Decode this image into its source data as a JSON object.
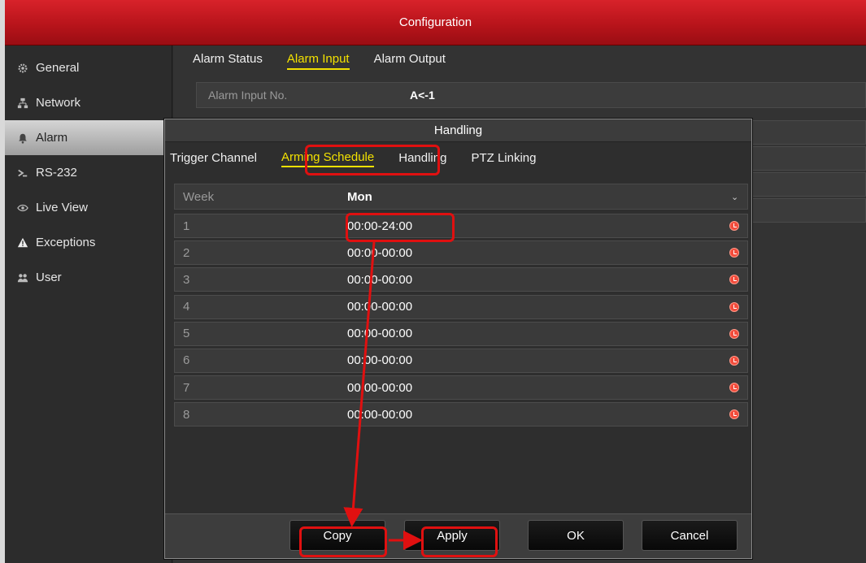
{
  "window": {
    "title": "Configuration"
  },
  "sidebar": {
    "items": [
      {
        "label": "General",
        "icon": "gear-icon"
      },
      {
        "label": "Network",
        "icon": "network-icon"
      },
      {
        "label": "Alarm",
        "icon": "bell-icon"
      },
      {
        "label": "RS-232",
        "icon": "serial-port-icon"
      },
      {
        "label": "Live View",
        "icon": "eye-icon"
      },
      {
        "label": "Exceptions",
        "icon": "warning-icon"
      },
      {
        "label": "User",
        "icon": "users-icon"
      }
    ],
    "active_index": 2
  },
  "content": {
    "tabs": [
      "Alarm Status",
      "Alarm Input",
      "Alarm Output"
    ],
    "active_tab": "Alarm Input",
    "alarm_input_label": "Alarm Input No.",
    "alarm_input_value": "A<-1"
  },
  "dialog": {
    "title": "Handling",
    "tabs": [
      "Trigger Channel",
      "Arming Schedule",
      "Handling",
      "PTZ Linking"
    ],
    "active_tab": "Arming Schedule",
    "week_label": "Week",
    "week_value": "Mon",
    "schedule": [
      {
        "num": "1",
        "time": "00:00-24:00"
      },
      {
        "num": "2",
        "time": "00:00-00:00"
      },
      {
        "num": "3",
        "time": "00:00-00:00"
      },
      {
        "num": "4",
        "time": "00:00-00:00"
      },
      {
        "num": "5",
        "time": "00:00-00:00"
      },
      {
        "num": "6",
        "time": "00:00-00:00"
      },
      {
        "num": "7",
        "time": "00:00-00:00"
      },
      {
        "num": "8",
        "time": "00:00-00:00"
      }
    ],
    "buttons": {
      "copy": "Copy",
      "apply": "Apply",
      "ok": "OK",
      "cancel": "Cancel"
    }
  },
  "colors": {
    "title_bar": "#c4161c",
    "active_tab": "#f3e100",
    "annotation": "#e01010",
    "clock_icon": "#f24c3c"
  }
}
